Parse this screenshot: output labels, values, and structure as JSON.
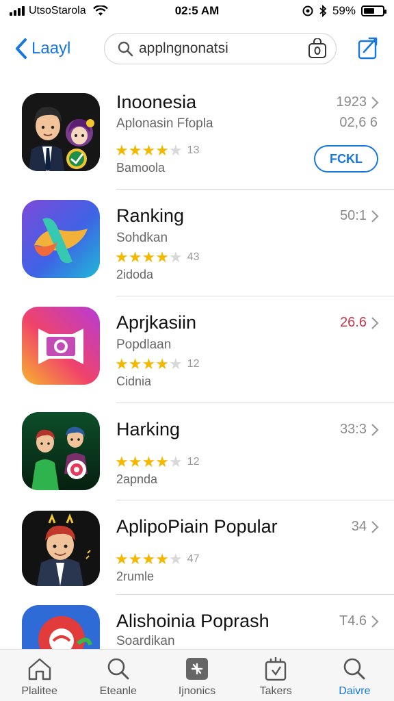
{
  "status_bar": {
    "carrier": "UtsoStarola",
    "time": "02:5 AM",
    "battery": "59%",
    "battery_level": 0.59
  },
  "nav": {
    "back_label": "Laayl",
    "search_value": "applngnonatsi"
  },
  "apps": [
    {
      "title": "Inoonesia",
      "subtitle": "Aplonasin Ffopla",
      "rating_count": "13",
      "tertiary": "Bamoola",
      "meta": "1923",
      "meta2": "02,6 6",
      "button": "FCKL",
      "rating": 4.0
    },
    {
      "title": "Ranking",
      "subtitle": "Sohdkan",
      "rating_count": "43",
      "tertiary": "2idoda",
      "meta": "50:1",
      "rating": 3.5
    },
    {
      "title": "Aprjkasiin",
      "subtitle": "Popdlaan",
      "rating_count": "12",
      "tertiary": "Cidnia",
      "meta": "26.6",
      "rating": 3.5
    },
    {
      "title": "Harking",
      "subtitle": "",
      "rating_count": "12",
      "tertiary": "2apnda",
      "meta": "33:3",
      "rating": 3.5
    },
    {
      "title": "AplipoPiain Popular",
      "subtitle": "",
      "rating_count": "47",
      "tertiary": "2rumle",
      "meta": "34",
      "rating": 3.5
    },
    {
      "title": "Alishoinia Poprash",
      "subtitle": "Soardikan",
      "meta": "T4.6"
    }
  ],
  "tabs": [
    {
      "label": "Plalitee",
      "icon": "home-icon"
    },
    {
      "label": "Eteanle",
      "icon": "search-icon"
    },
    {
      "label": "Ijnonics",
      "icon": "apps-icon"
    },
    {
      "label": "Takers",
      "icon": "updates-icon"
    },
    {
      "label": "Daivre",
      "icon": "search-icon"
    }
  ],
  "colors": {
    "accent": "#1677e0",
    "star": "#f5b800",
    "price_red": "#c8364a"
  }
}
